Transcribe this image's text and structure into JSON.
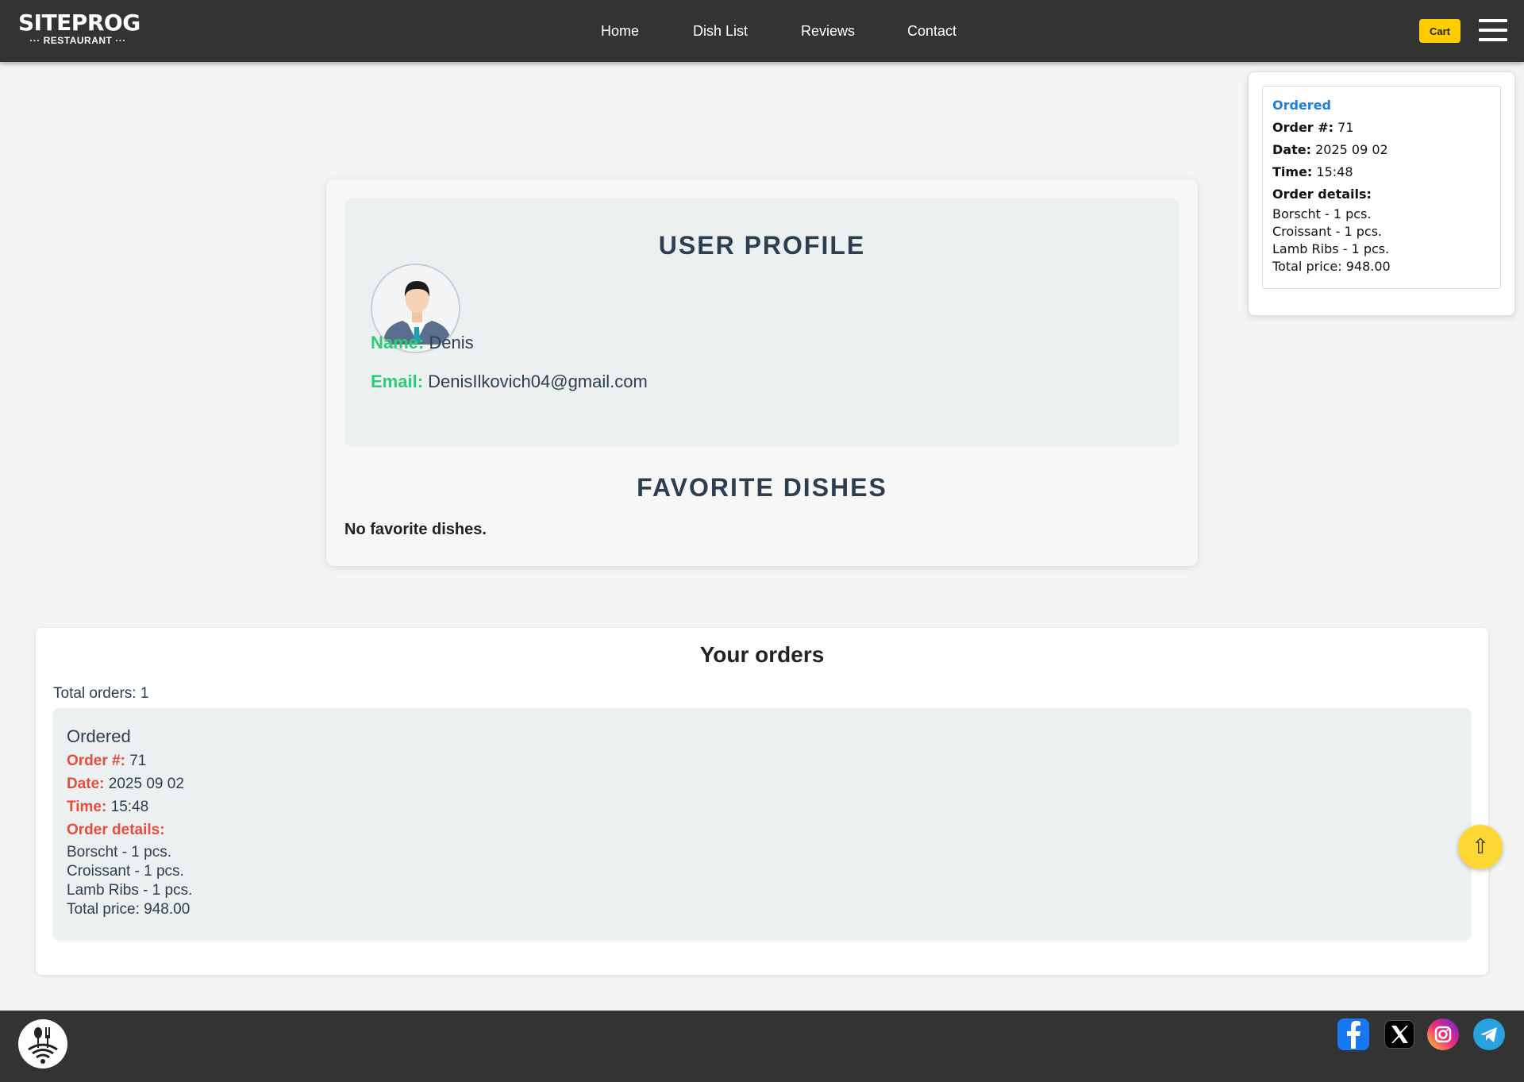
{
  "header": {
    "logo_main": "SITEPROG",
    "logo_sub": "··· RESTAURANT ···",
    "nav": [
      "Home",
      "Dish List",
      "Reviews",
      "Contact"
    ],
    "cart_label": "Cart",
    "menu_icon": "hamburger-icon"
  },
  "popup": {
    "status": "Ordered",
    "order_label": "Order #:",
    "order_number": "71",
    "date_label": "Date:",
    "date": "2025 09 02",
    "time_label": "Time:",
    "time": "15:48",
    "details_label": "Order details:",
    "items": [
      "Borscht - 1 pcs.",
      "Croissant - 1 pcs.",
      "Lamb Ribs - 1 pcs."
    ],
    "total": "Total price: 948.00"
  },
  "profile": {
    "title": "USER PROFILE",
    "avatar_icon": "user-avatar-icon",
    "name_label": "Name:",
    "name": "Denis",
    "email_label": "Email:",
    "email": "DenisIlkovich04@gmail.com",
    "favorites_title": "FAVORITE DISHES",
    "favorites_empty": "No favorite dishes."
  },
  "orders": {
    "title": "Your orders",
    "total_orders": "Total orders: 1",
    "list": [
      {
        "status": "Ordered",
        "order_label": "Order #:",
        "order_number": "71",
        "date_label": "Date:",
        "date": "2025 09 02",
        "time_label": "Time:",
        "time": "15:48",
        "details_label": "Order details:",
        "items": [
          "Borscht - 1 pcs.",
          "Croissant - 1 pcs.",
          "Lamb Ribs - 1 pcs."
        ],
        "total": "Total price: 948.00"
      }
    ]
  },
  "scroll_top": {
    "icon": "arrow-up-icon",
    "glyph": "⇧"
  },
  "footer": {
    "logo_icon": "restaurant-logo-icon",
    "social": [
      "facebook-icon",
      "x-icon",
      "instagram-icon",
      "telegram-icon"
    ]
  },
  "colors": {
    "header_bg": "#333333",
    "accent_yellow": "#ffcc00",
    "label_green": "#2ecc71",
    "label_red": "#e74c3c",
    "status_blue": "#1a7fe0",
    "page_bg": "#f4f4f4"
  }
}
